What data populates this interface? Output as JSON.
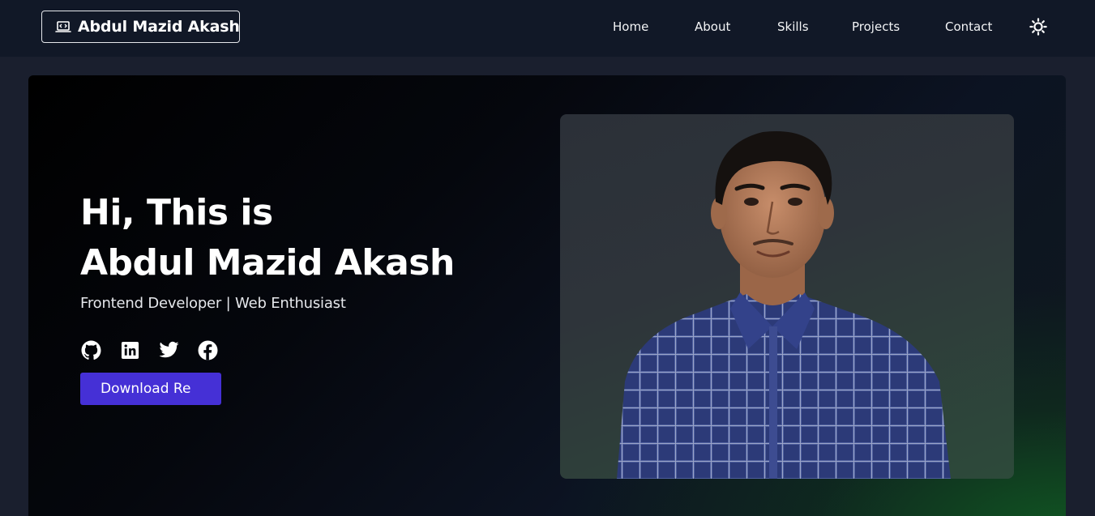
{
  "nav": {
    "brand_name": "Abdul Mazid Akash",
    "brand_icon": "code-laptop-icon",
    "links": [
      {
        "label": "Home"
      },
      {
        "label": "About"
      },
      {
        "label": "Skills"
      },
      {
        "label": "Projects"
      },
      {
        "label": "Contact"
      }
    ],
    "theme_toggle_icon": "sun-icon"
  },
  "hero": {
    "greeting": "Hi, This is",
    "name": "Abdul Mazid Akash",
    "subtitle": "Frontend Developer | Web Enthusiast",
    "socials": [
      {
        "icon": "github-icon"
      },
      {
        "icon": "linkedin-icon"
      },
      {
        "icon": "twitter-icon"
      },
      {
        "icon": "facebook-icon"
      }
    ],
    "download_label": "Download Re",
    "accent_color": "#4530d6",
    "background_glow_color": "#115e23"
  },
  "portrait": {
    "subject": "profile photo"
  }
}
